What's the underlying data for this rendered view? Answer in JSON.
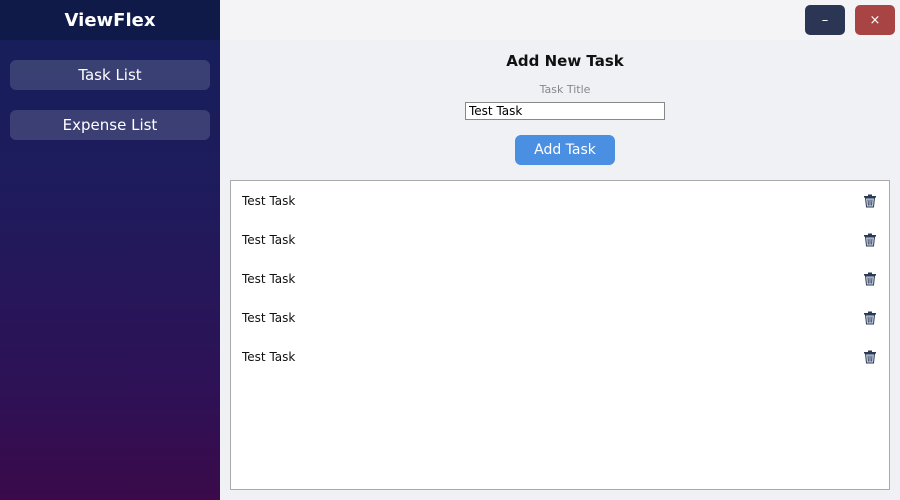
{
  "sidebar": {
    "title": "ViewFlex",
    "items": [
      {
        "label": "Task List"
      },
      {
        "label": "Expense List"
      }
    ]
  },
  "window_controls": {
    "minimize_label": "–",
    "close_label": "×"
  },
  "form": {
    "title": "Add New Task",
    "field_label": "Task Title",
    "input_value": "Test Task",
    "add_button_label": "Add Task"
  },
  "tasks": [
    {
      "title": "Test Task",
      "delete_icon": "trash-icon"
    },
    {
      "title": "Test Task",
      "delete_icon": "trash-icon"
    },
    {
      "title": "Test Task",
      "delete_icon": "trash-icon"
    },
    {
      "title": "Test Task",
      "delete_icon": "trash-icon"
    },
    {
      "title": "Test Task",
      "delete_icon": "trash-icon"
    }
  ],
  "colors": {
    "sidebar_header": "#0f1a48",
    "accent": "#4a8fe2",
    "close_button": "#a84444",
    "minimize_button": "#2b3655"
  }
}
